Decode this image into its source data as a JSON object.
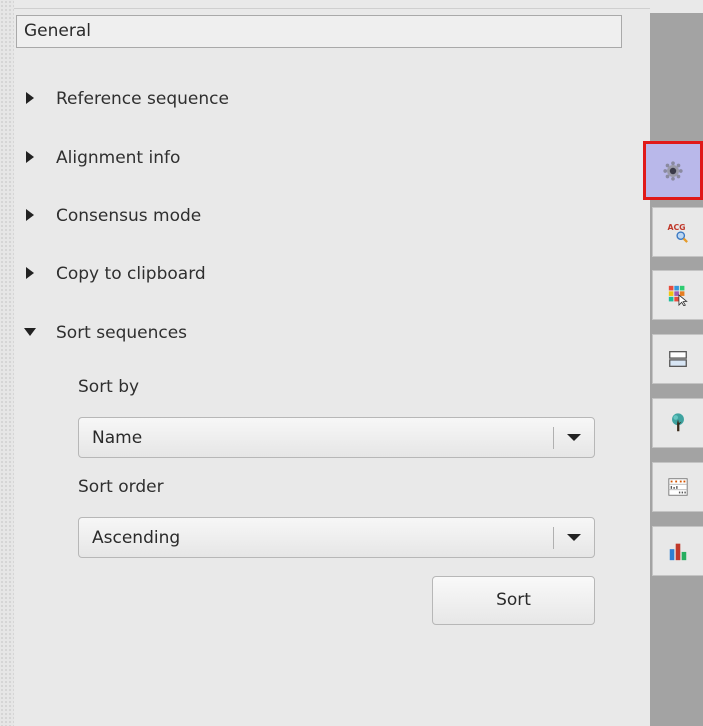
{
  "options_panel": {
    "group_title": "General",
    "sections": [
      {
        "label": "Reference sequence",
        "expanded": false
      },
      {
        "label": "Alignment info",
        "expanded": false
      },
      {
        "label": "Consensus mode",
        "expanded": false
      },
      {
        "label": "Copy to clipboard",
        "expanded": false
      },
      {
        "label": "Sort sequences",
        "expanded": true
      }
    ],
    "sort": {
      "sort_by_label": "Sort by",
      "sort_by_value": "Name",
      "sort_order_label": "Sort order",
      "sort_order_value": "Ascending",
      "sort_button_label": "Sort"
    }
  },
  "side_tabs": [
    {
      "icon": "gear-icon",
      "active": true
    },
    {
      "icon": "acg-search-icon",
      "active": false
    },
    {
      "icon": "highlight-grid-icon",
      "active": false
    },
    {
      "icon": "rows-layout-icon",
      "active": false
    },
    {
      "icon": "tree-icon",
      "active": false
    },
    {
      "icon": "statistics-grid-icon",
      "active": false
    },
    {
      "icon": "bar-chart-icon",
      "active": false
    }
  ],
  "colors": {
    "active_tab_background": "#b9b8ea",
    "active_tab_border": "#e01919",
    "right_bar": "#a3a3a3"
  }
}
